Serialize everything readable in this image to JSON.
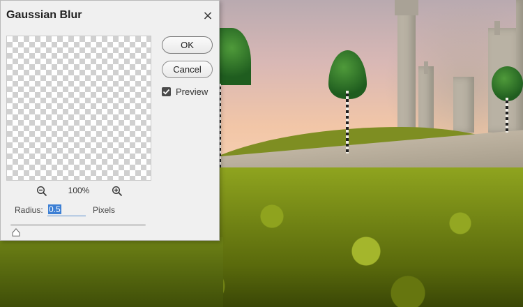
{
  "dialog": {
    "title": "Gaussian Blur",
    "close_label": "×",
    "zoom": {
      "level": "100%"
    },
    "buttons": {
      "ok": "OK",
      "cancel": "Cancel"
    },
    "preview": {
      "label": "Preview",
      "checked": true
    },
    "radius": {
      "label": "Radius:",
      "value": "0.5",
      "unit": "Pixels"
    },
    "slider": {
      "value_fraction": 0.02
    }
  },
  "colors": {
    "dialog_bg": "#f0f0f0",
    "input_highlight": "#3c7fd4",
    "checkbox": "#4a4a4a"
  },
  "icons": {
    "zoom_out": "zoom-out-icon",
    "zoom_in": "zoom-in-icon",
    "close": "close-icon",
    "check": "checkmark-icon"
  }
}
